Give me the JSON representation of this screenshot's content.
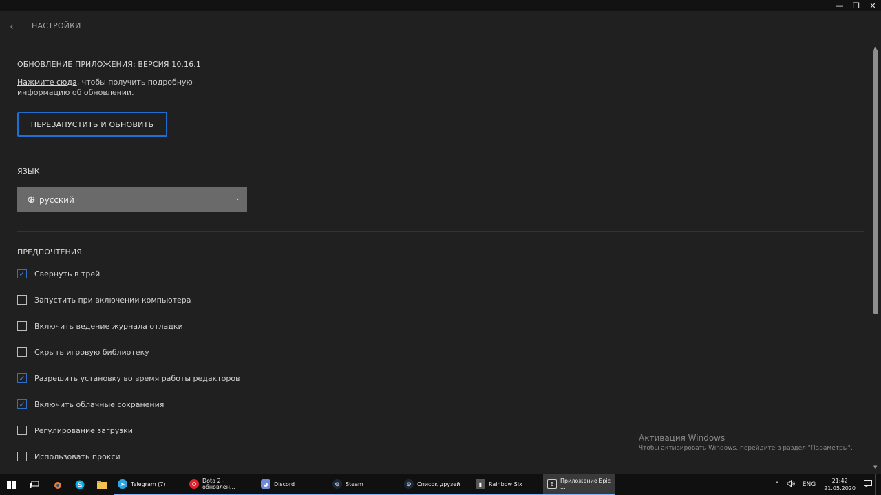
{
  "window": {
    "minimize_glyph": "—",
    "maximize_glyph": "❐",
    "close_glyph": "✕"
  },
  "header": {
    "back_glyph": "‹",
    "title": "НАСТРОЙКИ"
  },
  "update": {
    "title": "ОБНОВЛЕНИЕ ПРИЛОЖЕНИЯ: ВЕРСИЯ 10.16.1",
    "link_text": "Нажмите сюда",
    "info_text": ", чтобы получить подробную информацию об обновлении.",
    "restart_button": "ПЕРЕЗАПУСТИТЬ И ОБНОВИТЬ"
  },
  "language": {
    "title": "ЯЗЫК",
    "selected": "русский",
    "icon": "globe-icon"
  },
  "preferences": {
    "title": "ПРЕДПОЧТЕНИЯ",
    "items": [
      {
        "label": "Свернуть в трей",
        "checked": true
      },
      {
        "label": "Запустить при включении компьютера",
        "checked": false
      },
      {
        "label": "Включить ведение журнала отладки",
        "checked": false
      },
      {
        "label": "Скрыть игровую библиотеку",
        "checked": false
      },
      {
        "label": "Разрешить установку во время работы редакторов",
        "checked": true
      },
      {
        "label": "Включить облачные сохранения",
        "checked": true
      },
      {
        "label": "Регулирование загрузки",
        "checked": false
      },
      {
        "label": "Использовать прокси",
        "checked": false
      }
    ]
  },
  "watermark": {
    "title": "Активация Windows",
    "subtitle": "Чтобы активировать Windows, перейдите в раздел \"Параметры\"."
  },
  "taskbar": {
    "apps": [
      {
        "label": "Telegram (7)",
        "icon": "telegram-icon",
        "color": "#2ca5e0"
      },
      {
        "label": "Dota 2 - обновлен...",
        "icon": "opera-icon",
        "color": "#e0232b"
      },
      {
        "label": "Discord",
        "icon": "discord-icon",
        "color": "#7289da"
      },
      {
        "label": "Steam",
        "icon": "steam-icon",
        "color": "#1b2838"
      },
      {
        "label": "Список друзей",
        "icon": "steam-friends-icon",
        "color": "#1b2838"
      },
      {
        "label": "Rainbow Six",
        "icon": "rainbow-six-icon",
        "color": "#555555"
      },
      {
        "label": "Приложение Epic ...",
        "icon": "epic-games-icon",
        "color": "#2a2a2a"
      }
    ],
    "tray": {
      "chevron": "⌃",
      "volume": "🔊",
      "language": "ENG",
      "time": "21:42",
      "date": "21.05.2020"
    }
  }
}
